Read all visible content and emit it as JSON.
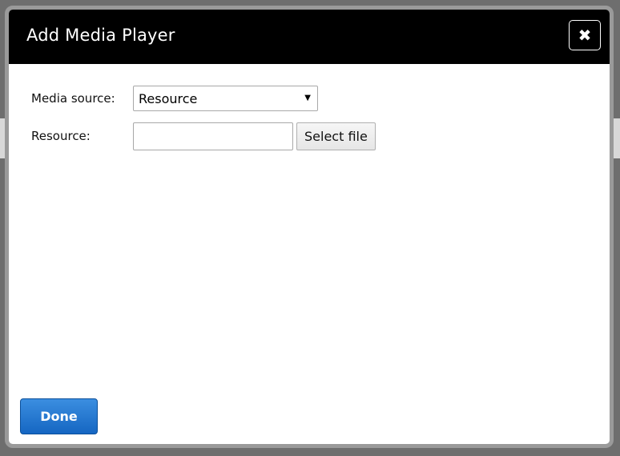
{
  "dialog": {
    "title": "Add Media Player",
    "close_icon": "close-icon",
    "close_glyph": "✖"
  },
  "form": {
    "media_source": {
      "label": "Media source:",
      "selected": "Resource",
      "arrow": "▼"
    },
    "resource": {
      "label": "Resource:",
      "value": "",
      "select_file_label": "Select file"
    }
  },
  "footer": {
    "done_label": "Done"
  },
  "colors": {
    "header_bg": "#000000",
    "primary_button": "#1f74cf"
  }
}
